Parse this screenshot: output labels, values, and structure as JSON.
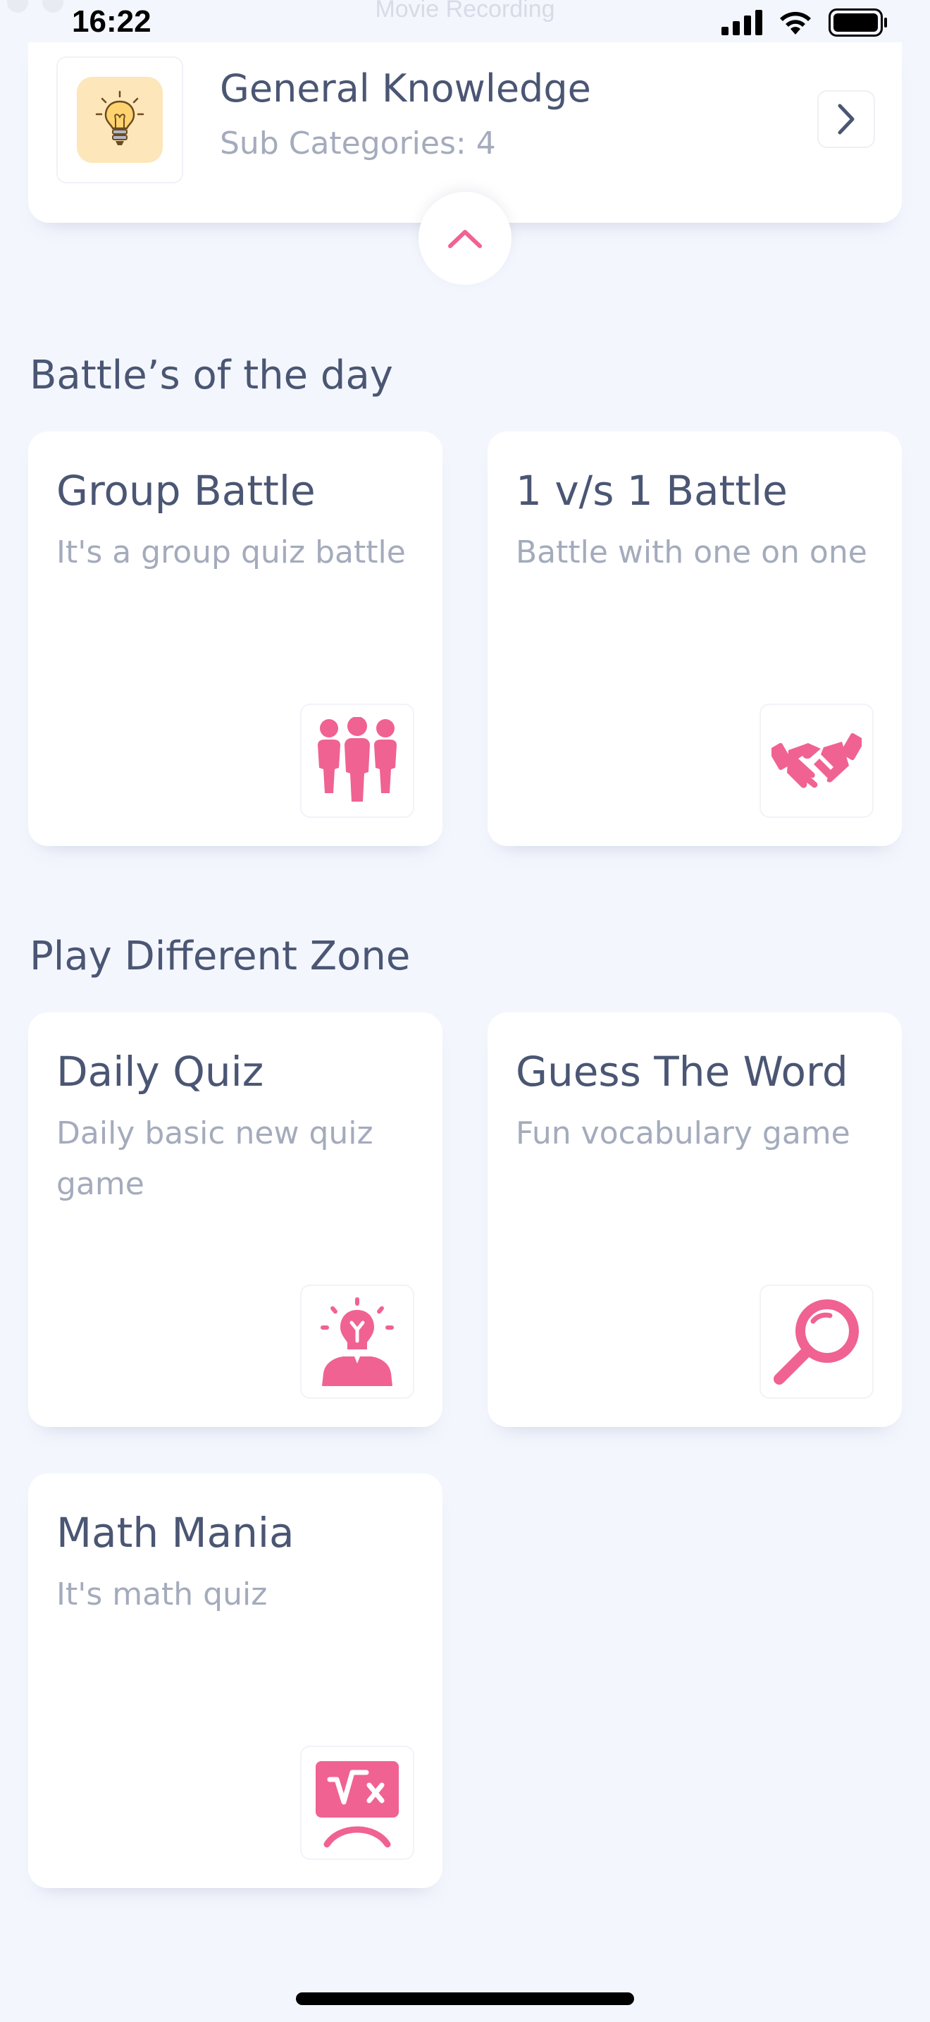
{
  "status_bar": {
    "time": "16:22",
    "recording_label": "Movie Recording"
  },
  "category": {
    "title": "General Knowledge",
    "subtitle": "Sub Categories: 4",
    "icon": "lightbulb-icon"
  },
  "battles": {
    "section_title": "Battle’s of the day",
    "tiles": [
      {
        "title": "Group Battle",
        "description": "It's a group quiz battle",
        "icon": "group-icon"
      },
      {
        "title": "1 v/s 1 Battle",
        "description": "Battle with one on one",
        "icon": "handshake-icon"
      }
    ]
  },
  "zones": {
    "section_title": "Play Different Zone",
    "tiles": [
      {
        "title": "Daily Quiz",
        "description": "Daily basic new quiz game",
        "icon": "idea-person-icon"
      },
      {
        "title": "Guess The Word",
        "description": "Fun vocabulary game",
        "icon": "magnifier-icon"
      },
      {
        "title": "Math Mania",
        "description": "It's math quiz",
        "icon": "math-board-icon"
      }
    ]
  },
  "colors": {
    "accent": "#f06292",
    "text": "#4a5673",
    "muted": "#a4abbc",
    "background": "#f3f6fd"
  }
}
